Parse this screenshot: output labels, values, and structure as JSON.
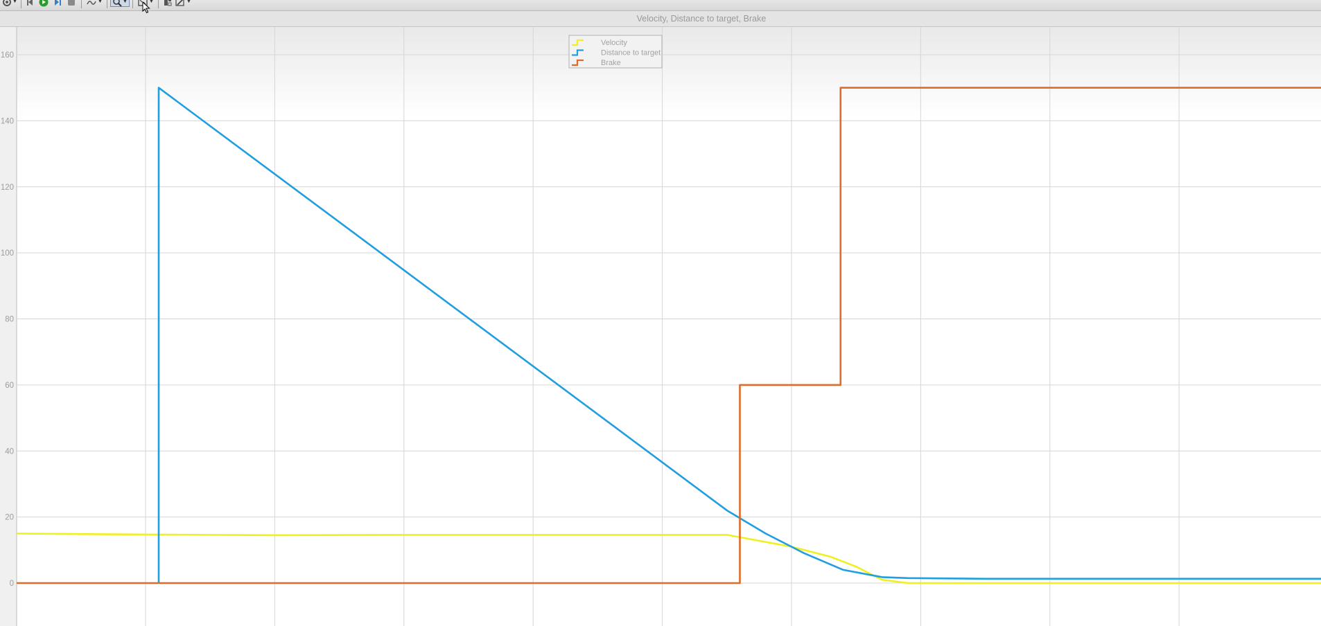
{
  "window": {
    "title": "Velocity, Distance to target, Brake"
  },
  "toolbar": {
    "items": [
      {
        "name": "settings-icon",
        "dropdown": true
      },
      {
        "name": "step-back-icon"
      },
      {
        "name": "run-icon"
      },
      {
        "name": "step-forward-icon"
      },
      {
        "name": "stop-icon"
      },
      {
        "name": "highlight-icon",
        "dropdown": true
      },
      {
        "name": "zoom-icon",
        "dropdown": true,
        "active": true
      },
      {
        "name": "fit-to-view-icon",
        "dropdown": true
      },
      {
        "name": "layout-icon"
      },
      {
        "name": "style-icon",
        "dropdown": true
      }
    ],
    "colors": {
      "run": "#2e9a2e",
      "stop": "#8a8a8a",
      "active_bg": "#cfd8e6"
    }
  },
  "chart_data": {
    "type": "line",
    "title": "Velocity, Distance to target, Brake",
    "ylim": [
      -13,
      168
    ],
    "xlim": [
      0,
      10.1
    ],
    "yticks": [
      0,
      20,
      40,
      60,
      80,
      100,
      120,
      140,
      160
    ],
    "xtick_count": 11,
    "grid": true,
    "legend_position": "top-center",
    "series": [
      {
        "name": "Velocity",
        "color": "#f0f020",
        "points": [
          [
            0,
            15
          ],
          [
            1,
            14.7
          ],
          [
            2,
            14.5
          ],
          [
            3,
            14.6
          ],
          [
            4,
            14.6
          ],
          [
            5,
            14.6
          ],
          [
            5.5,
            14.6
          ],
          [
            6.0,
            11
          ],
          [
            6.3,
            8
          ],
          [
            6.5,
            5
          ],
          [
            6.7,
            1
          ],
          [
            6.9,
            0
          ],
          [
            7.5,
            0
          ],
          [
            8.5,
            0
          ],
          [
            10.1,
            0
          ]
        ]
      },
      {
        "name": "Distance to target",
        "color": "#1f9ee0",
        "points": [
          [
            1.1,
            0
          ],
          [
            1.1,
            150
          ],
          [
            5.5,
            22
          ],
          [
            5.8,
            15
          ],
          [
            6.1,
            9
          ],
          [
            6.4,
            4
          ],
          [
            6.7,
            1.8
          ],
          [
            6.9,
            1.5
          ],
          [
            7.5,
            1.3
          ],
          [
            10.1,
            1.3
          ]
        ]
      },
      {
        "name": "Brake",
        "color": "#e06a2a",
        "points": [
          [
            0,
            0
          ],
          [
            5.6,
            0
          ],
          [
            5.6,
            60
          ],
          [
            6.38,
            60
          ],
          [
            6.38,
            150
          ],
          [
            10.1,
            150
          ]
        ]
      }
    ]
  }
}
